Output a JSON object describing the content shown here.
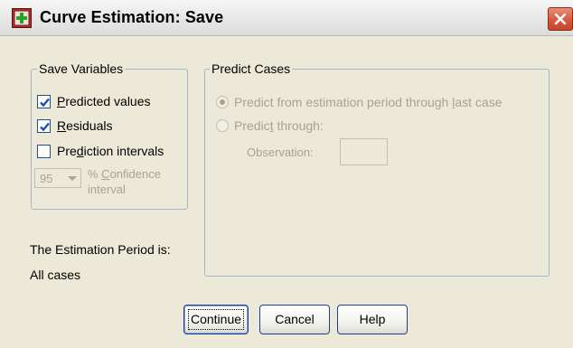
{
  "window": {
    "title": "Curve Estimation: Save",
    "app_icon": "spss-dialog-icon",
    "close_icon": "close-icon"
  },
  "save_variables": {
    "legend": "Save Variables",
    "items": [
      {
        "label": "Predicted values",
        "checked": true
      },
      {
        "label": "Residuals",
        "checked": true
      },
      {
        "label": "Prediction intervals",
        "checked": false
      }
    ],
    "confidence": {
      "value": "95",
      "label_line1": "% Confidence",
      "label_line2": "interval",
      "enabled": false
    }
  },
  "predict_cases": {
    "legend": "Predict Cases",
    "options": [
      {
        "label": "Predict from estimation period through last case",
        "selected": true,
        "enabled": false
      },
      {
        "label": "Predict through:",
        "selected": false,
        "enabled": false
      }
    ],
    "observation": {
      "label": "Observation:",
      "value": ""
    }
  },
  "estimation": {
    "label": "The Estimation Period is:",
    "value": "All cases"
  },
  "buttons": {
    "continue": "Continue",
    "cancel": "Cancel",
    "help": "Help"
  },
  "colors": {
    "dialog_bg": "#ece9d8",
    "disabled_text": "#a6a394",
    "checkmark": "#1f4ea8",
    "close_button": "#d65b40"
  }
}
